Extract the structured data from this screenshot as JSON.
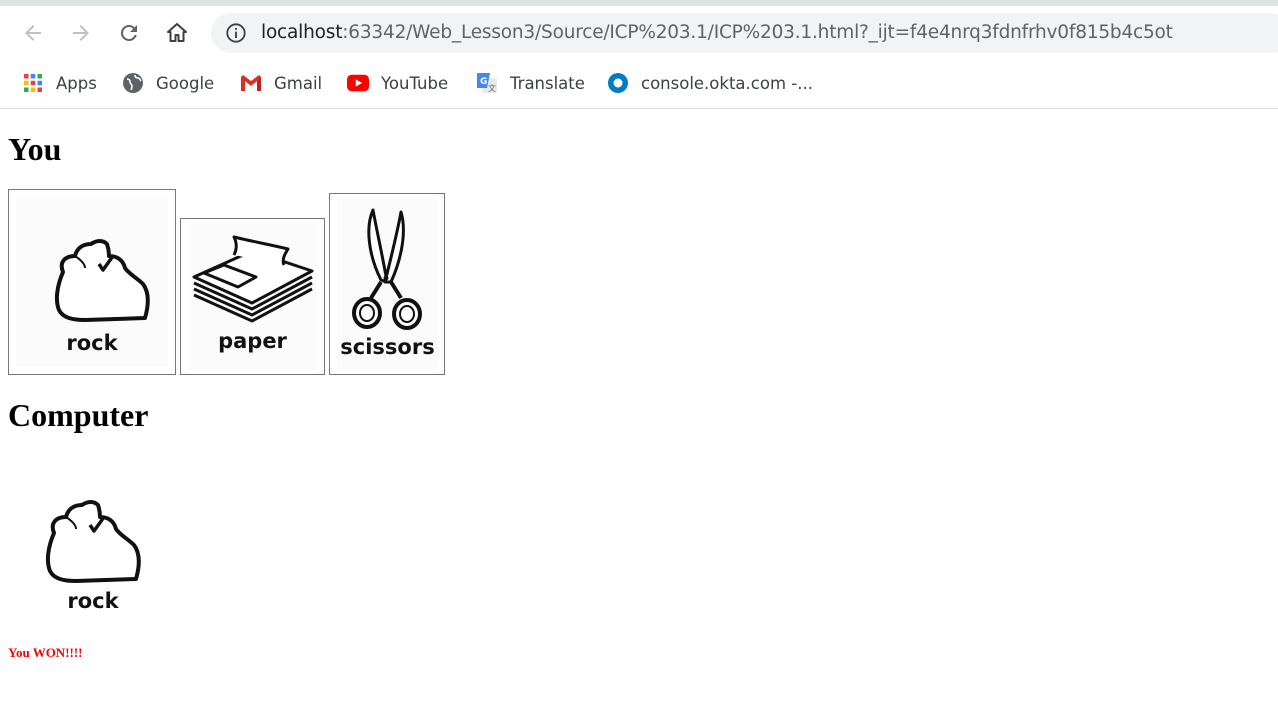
{
  "browser": {
    "url_host": "localhost",
    "url_rest": ":63342/Web_Lesson3/Source/ICP%203.1/ICP%203.1.html?_ijt=f4e4nrq3fdnfrhv0f815b4c5ot",
    "bookmarks": [
      {
        "label": "Apps",
        "icon": "apps-grid-icon"
      },
      {
        "label": "Google",
        "icon": "globe-icon"
      },
      {
        "label": "Gmail",
        "icon": "gmail-icon"
      },
      {
        "label": "YouTube",
        "icon": "youtube-icon"
      },
      {
        "label": "Translate",
        "icon": "translate-icon"
      },
      {
        "label": "console.okta.com -...",
        "icon": "okta-icon"
      }
    ]
  },
  "game": {
    "player_heading": "You",
    "computer_heading": "Computer",
    "choices": [
      {
        "id": "rock",
        "label": "rock"
      },
      {
        "id": "paper",
        "label": "paper"
      },
      {
        "id": "scissors",
        "label": "scissors"
      }
    ],
    "computer_choice": {
      "id": "rock",
      "label": "rock"
    },
    "result_text": "You WON!!!!",
    "result_color": "#ff0000"
  }
}
